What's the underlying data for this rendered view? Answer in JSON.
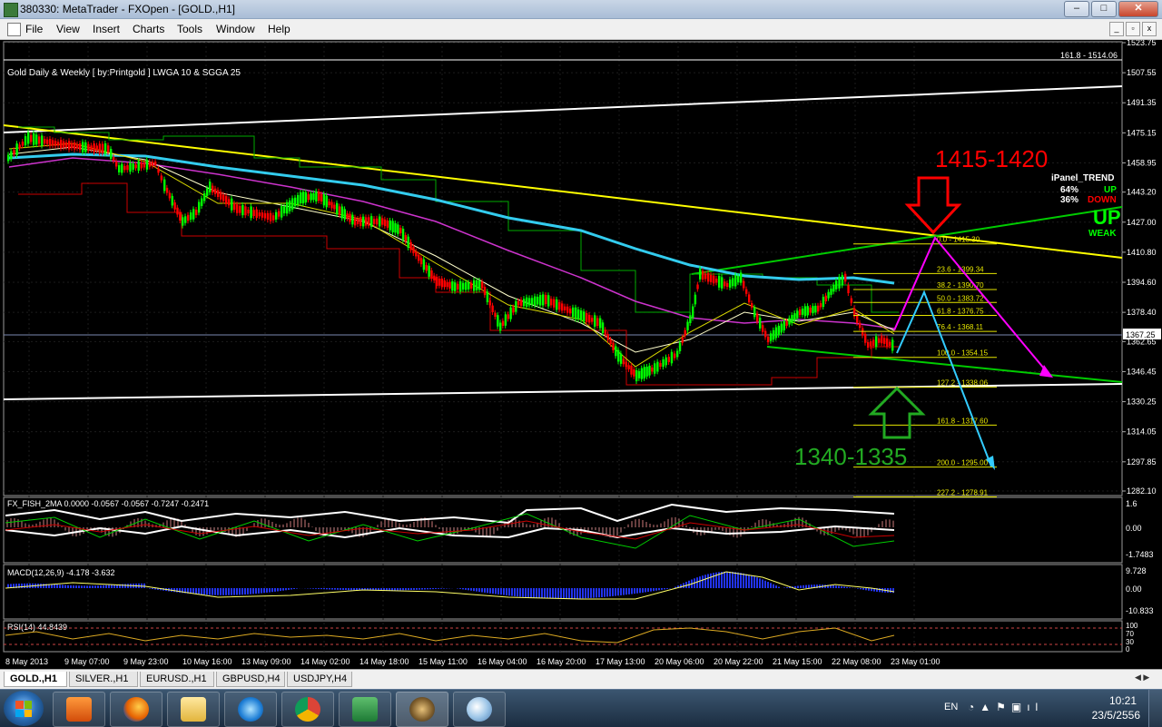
{
  "window": {
    "title": "380330: MetaTrader - FXOpen - [GOLD.,H1]"
  },
  "window_buttons": {
    "minimize": "–",
    "maximize": "□",
    "close": "✕"
  },
  "menu": [
    "File",
    "View",
    "Insert",
    "Charts",
    "Tools",
    "Window",
    "Help"
  ],
  "mdi_buttons": {
    "minimize": "_",
    "restore": "▫",
    "close": "x"
  },
  "chart": {
    "header": "Gold Daily & Weekly [ by:Printgold ] LWGA 10  &  SGGA 25",
    "price_axis": [
      "1523.75",
      "1507.55",
      "1491.35",
      "1475.15",
      "1458.95",
      "1443.20",
      "1427.00",
      "1410.80",
      "1394.60",
      "1378.40",
      "1362.65",
      "1346.45",
      "1330.25",
      "1314.05",
      "1297.85",
      "1282.10"
    ],
    "current_price": "1367.25",
    "top_fib_label": "161.8 - 1514.06",
    "fib_levels": [
      {
        "label": "0.0 - 1415.30",
        "level": 1415.3
      },
      {
        "label": "23.6 - 1399.34",
        "level": 1399.34
      },
      {
        "label": "38.2 - 1390.70",
        "level": 1390.7
      },
      {
        "label": "50.0 - 1383.72",
        "level": 1383.72
      },
      {
        "label": "61.8 - 1376.75",
        "level": 1376.75
      },
      {
        "label": "76.4 - 1368.11",
        "level": 1368.11
      },
      {
        "label": "100.0 - 1354.15",
        "level": 1354.15
      },
      {
        "label": "127.2 - 1338.06",
        "level": 1338.06
      },
      {
        "label": "161.8 - 1317.60",
        "level": 1317.6
      },
      {
        "label": "200.0 - 1295.00",
        "level": 1295.0
      },
      {
        "label": "227.2 - 1278.91",
        "level": 1278.91
      }
    ],
    "annotation_high": "1415-1420",
    "annotation_low": "1340-1335",
    "ipanel": {
      "title": "iPanel_TREND",
      "up_pct": "64%",
      "up_label": "UP",
      "down_pct": "36%",
      "down_label": "DOWN",
      "big": "UP",
      "strength": "WEAK"
    },
    "time_axis": [
      "8 May 2013",
      "9 May 07:00",
      "9 May 23:00",
      "10 May 16:00",
      "13 May 09:00",
      "14 May 02:00",
      "14 May 18:00",
      "15 May 11:00",
      "16 May 04:00",
      "16 May 20:00",
      "17 May 13:00",
      "20 May 06:00",
      "20 May 22:00",
      "21 May 15:00",
      "22 May 08:00",
      "23 May 01:00"
    ]
  },
  "fisher": {
    "label": "FX_FISH_2MA 0.0000 -0.0567 -0.0567 -0.7247 -0.2471",
    "axis": [
      "1.6",
      "0.00",
      "-1.7483"
    ]
  },
  "macd": {
    "label": "MACD(12,26,9) -4.178 -3.632",
    "axis": [
      "9.728",
      "0.00",
      "-10.833"
    ]
  },
  "rsi": {
    "label": "RSI(14) 44.8439",
    "axis": [
      "100",
      "70",
      "30",
      "0"
    ]
  },
  "tabs": [
    "GOLD.,H1",
    "SILVER.,H1",
    "EURUSD.,H1",
    "GBPUSD,H4",
    "USDJPY,H4"
  ],
  "active_tab": "GOLD.,H1",
  "taskbar": {
    "lang": "EN",
    "time": "10:21",
    "date": "23/5/2556",
    "apps": [
      "media-player",
      "firefox",
      "file-explorer",
      "internet-explorer",
      "chrome",
      "excel",
      "metatrader",
      "paint"
    ]
  },
  "colors": {
    "bull": "#00ff00",
    "bear": "#ff0000",
    "fib": "#e6e600",
    "trend_yellow": "#ffff00",
    "trend_green": "#00cc00",
    "ma_cyan": "#33ccee",
    "ma_magenta": "#cc33cc",
    "arrow_red": "#ff0000",
    "arrow_green": "#22aa22",
    "projection_magenta": "#ff00ff",
    "projection_cyan": "#33ccff"
  }
}
